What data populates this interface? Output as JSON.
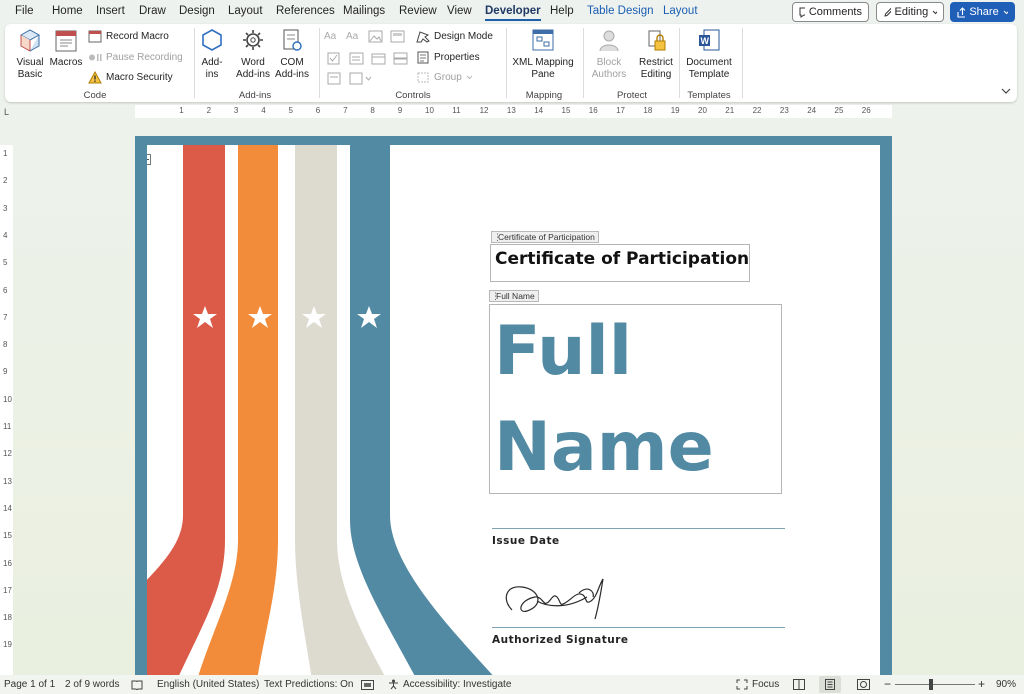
{
  "menu": {
    "tabs": [
      "File",
      "Home",
      "Insert",
      "Draw",
      "Design",
      "Layout",
      "References",
      "Mailings",
      "Review",
      "View",
      "Developer",
      "Help",
      "Table Design",
      "Layout"
    ],
    "active": "Developer",
    "comments": "Comments",
    "editing": "Editing",
    "share": "Share"
  },
  "ribbon": {
    "code": {
      "label": "Code",
      "visual_basic": "Visual Basic",
      "macros": "Macros",
      "record_macro": "Record Macro",
      "pause_recording": "Pause Recording",
      "macro_security": "Macro Security"
    },
    "addins": {
      "label": "Add-ins",
      "addins": "Add-ins",
      "word_addins": "Word Add-ins",
      "com_addins": "COM Add-ins"
    },
    "controls": {
      "label": "Controls",
      "design_mode": "Design Mode",
      "properties": "Properties",
      "group": "Group"
    },
    "mapping": {
      "label": "Mapping",
      "xml_mapping": "XML Mapping Pane"
    },
    "protect": {
      "label": "Protect",
      "block_authors": "Block Authors",
      "restrict_editing": "Restrict Editing"
    },
    "templates": {
      "label": "Templates",
      "document_template": "Document Template"
    }
  },
  "ruler": {
    "h": [
      "1",
      "2",
      "3",
      "4",
      "5",
      "6",
      "7",
      "8",
      "9",
      "10",
      "11",
      "12",
      "13",
      "14",
      "15",
      "16",
      "17",
      "18",
      "19",
      "20",
      "21",
      "22",
      "23",
      "24",
      "25",
      "26"
    ],
    "v": [
      "1",
      "2",
      "3",
      "4",
      "5",
      "6",
      "7",
      "8",
      "9",
      "10",
      "11",
      "12",
      "13",
      "14",
      "15",
      "16",
      "17",
      "18",
      "19"
    ]
  },
  "document": {
    "title_tag": "Certificate of Participation",
    "title": "Certificate of Participation",
    "name_tag": "Full Name",
    "name_line1": "Full",
    "name_line2": "Name",
    "issue_date": "Issue Date",
    "signature_label": "Authorized Signature",
    "colors": {
      "red": "#dc5a48",
      "orange": "#f28c3a",
      "beige": "#dddbd0",
      "teal": "#528aa4"
    }
  },
  "status": {
    "page": "Page 1 of 1",
    "words": "2 of 9 words",
    "language": "English (United States)",
    "predictions": "Text Predictions: On",
    "accessibility": "Accessibility: Investigate",
    "focus": "Focus",
    "zoom": "90%"
  }
}
